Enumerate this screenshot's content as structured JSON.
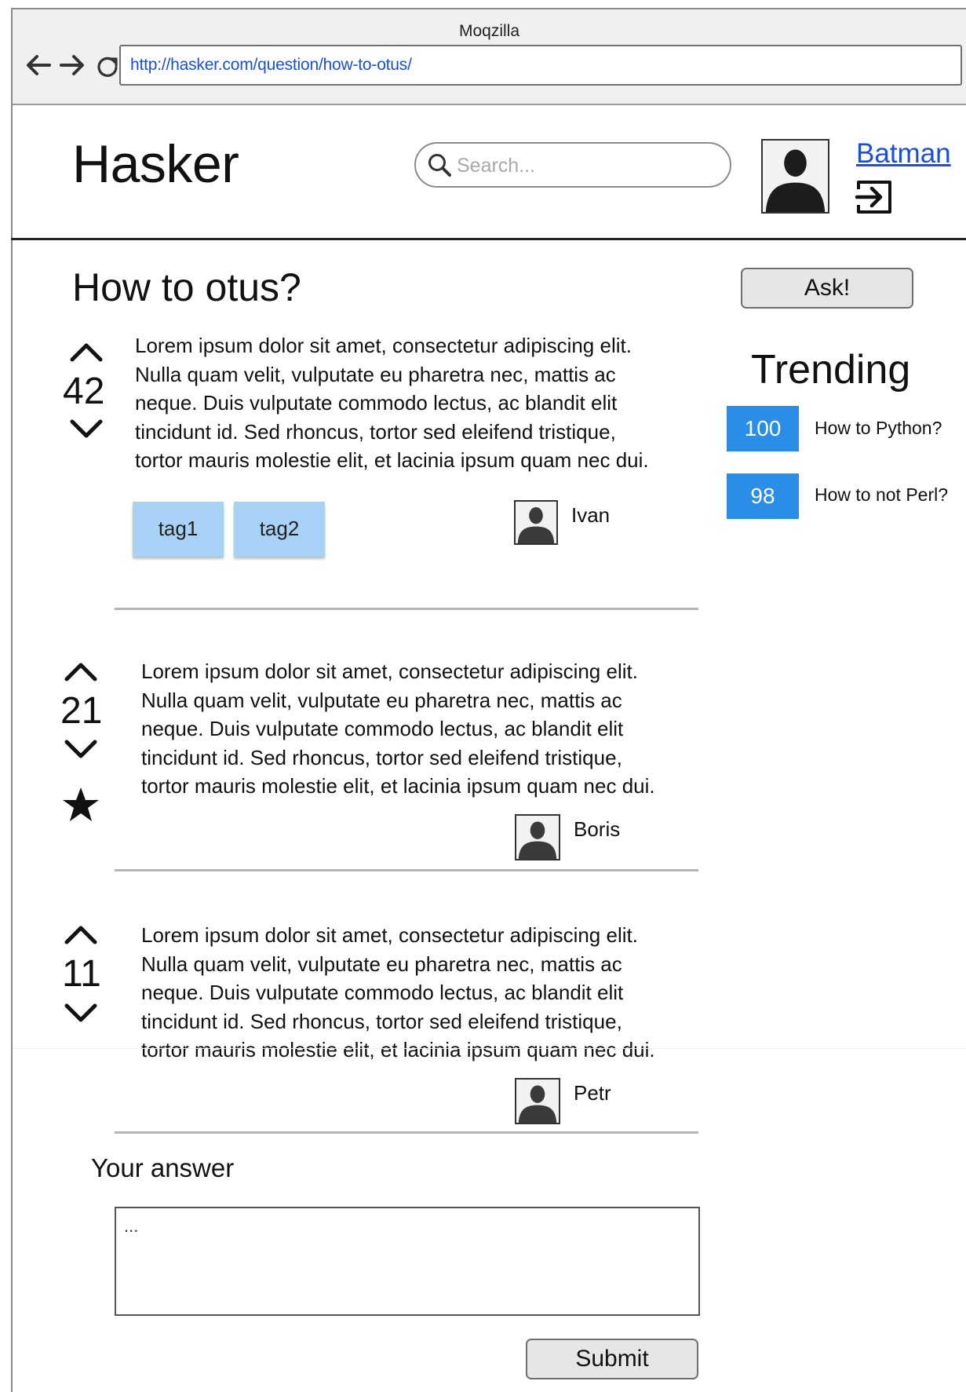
{
  "browser": {
    "window_title": "Moqzilla",
    "url": "http://hasker.com/question/how-to-otus/",
    "icons": [
      "back-arrow-icon",
      "forward-arrow-icon",
      "reload-icon"
    ]
  },
  "header": {
    "brand": "Hasker",
    "search_placeholder": "Search...",
    "search_icon": "search-icon",
    "user_name": "Batman",
    "logout_icon": "logout-icon"
  },
  "question": {
    "title": "How to otus?",
    "votes": "42",
    "text_lines": [
      "Lorem ipsum dolor sit amet, consectetur adipiscing elit.",
      "Nulla quam velit, vulputate eu pharetra nec, mattis ac",
      "neque. Duis vulputate commodo lectus, ac blandit elit",
      "tincidunt id. Sed rhoncus, tortor sed eleifend tristique,",
      "tortor mauris molestie elit, et lacinia ipsum quam nec dui."
    ],
    "tags": [
      "tag1",
      "tag2"
    ],
    "author": "Ivan"
  },
  "answers": [
    {
      "votes": "21",
      "accepted": true,
      "text_lines": [
        "Lorem ipsum dolor sit amet, consectetur adipiscing elit.",
        "Nulla quam velit, vulputate eu pharetra nec, mattis ac",
        "neque. Duis vulputate commodo lectus, ac blandit elit",
        "tincidunt id. Sed rhoncus, tortor sed eleifend tristique,",
        "tortor mauris molestie elit, et lacinia ipsum quam nec dui."
      ],
      "author": "Boris"
    },
    {
      "votes": "11",
      "accepted": false,
      "text_lines": [
        "Lorem ipsum dolor sit amet, consectetur adipiscing elit.",
        "Nulla quam velit, vulputate eu pharetra nec, mattis ac",
        "neque. Duis vulputate commodo lectus, ac blandit elit",
        "tincidunt id. Sed rhoncus, tortor sed eleifend tristique,",
        "tortor mauris molestie elit, et lacinia ipsum quam nec dui."
      ],
      "author": "Petr"
    }
  ],
  "sidebar": {
    "ask_label": "Ask!",
    "trending_title": "Trending",
    "trending": [
      {
        "count": "100",
        "title": "How to Python?"
      },
      {
        "count": "98",
        "title": "How to not Perl?"
      }
    ]
  },
  "answer_form": {
    "label": "Your answer",
    "value": "...",
    "submit_label": "Submit"
  },
  "colors": {
    "link": "#1a4fd6",
    "badge": "#2b8ee6",
    "tag": "#a7d2f5"
  }
}
